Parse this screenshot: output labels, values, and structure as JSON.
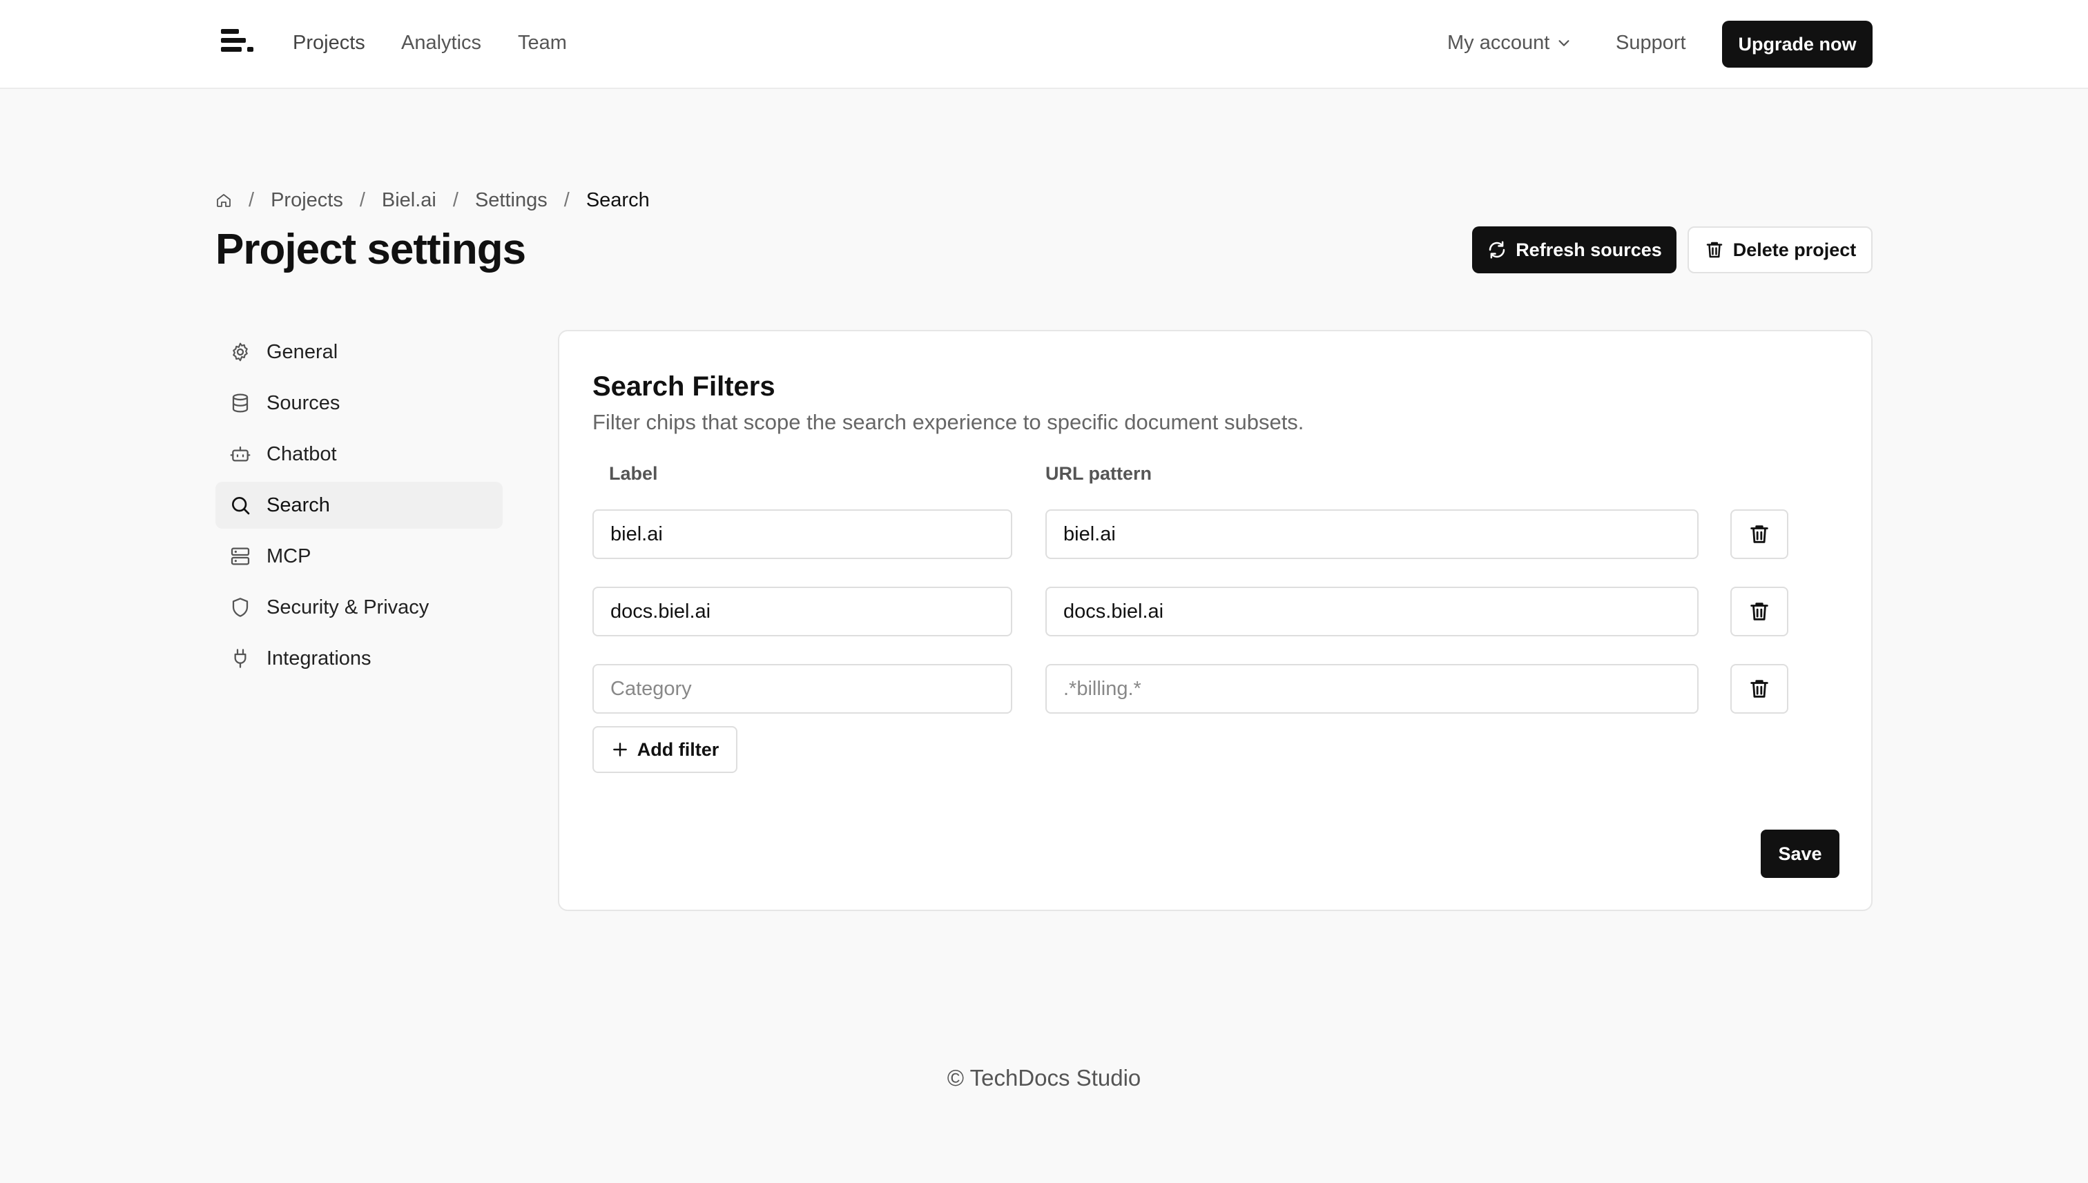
{
  "topbar": {
    "nav": [
      "Projects",
      "Analytics",
      "Team"
    ],
    "account_label": "My account",
    "support_label": "Support",
    "upgrade_label": "Upgrade now"
  },
  "breadcrumb": {
    "items": [
      "Projects",
      "Biel.ai",
      "Settings"
    ],
    "current": "Search",
    "separator": "/"
  },
  "page": {
    "title": "Project settings",
    "refresh_label": "Refresh sources",
    "delete_label": "Delete project"
  },
  "sidebar": {
    "items": [
      {
        "label": "General",
        "icon": "gear-icon"
      },
      {
        "label": "Sources",
        "icon": "database-icon"
      },
      {
        "label": "Chatbot",
        "icon": "bot-icon"
      },
      {
        "label": "Search",
        "icon": "search-icon",
        "active": true
      },
      {
        "label": "MCP",
        "icon": "server-icon"
      },
      {
        "label": "Security & Privacy",
        "icon": "shield-icon"
      },
      {
        "label": "Integrations",
        "icon": "plug-icon"
      }
    ]
  },
  "filters": {
    "title": "Search Filters",
    "description": "Filter chips that scope the search experience to specific document subsets.",
    "label_header": "Label",
    "pattern_header": "URL pattern",
    "rows": [
      {
        "label": "biel.ai",
        "pattern": "biel.ai"
      },
      {
        "label": "docs.biel.ai",
        "pattern": "docs.biel.ai"
      },
      {
        "label": "",
        "label_placeholder": "Category",
        "pattern": "",
        "pattern_placeholder": ".*billing.*"
      }
    ],
    "add_label": "Add filter",
    "save_label": "Save"
  },
  "footer": {
    "text": "© TechDocs Studio"
  },
  "colors": {
    "primary": "#111111",
    "background": "#f9f9f9",
    "card": "#ffffff",
    "active_nav": "#f0f0f0"
  }
}
